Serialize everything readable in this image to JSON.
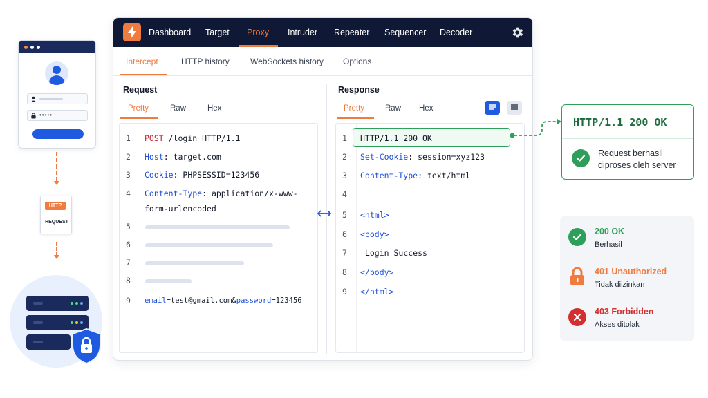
{
  "nav": {
    "items": [
      "Dashboard",
      "Target",
      "Proxy",
      "Intruder",
      "Repeater",
      "Sequencer",
      "Decoder"
    ],
    "active": "Proxy"
  },
  "subtabs": {
    "items": [
      "Intercept",
      "HTTP history",
      "WebSockets history",
      "Options"
    ],
    "active": "Intercept"
  },
  "request": {
    "title": "Request",
    "tabs": [
      "Pretty",
      "Raw",
      "Hex"
    ],
    "active_tab": "Pretty",
    "lines": [
      {
        "n": "1",
        "key": "POST",
        "rest": " /login HTTP/1.1"
      },
      {
        "n": "2",
        "key": "Host",
        "rest": ": target.com"
      },
      {
        "n": "3",
        "key": "Cookie",
        "rest": ": PHPSESSID=123456"
      },
      {
        "n": "4",
        "key": "Content-Type",
        "rest": ": application/x-www-",
        "cont": "form-urlencoded"
      },
      {
        "n": "5"
      },
      {
        "n": "6"
      },
      {
        "n": "7"
      },
      {
        "n": "8"
      },
      {
        "n": "9",
        "k1": "email",
        "v1": "=test@gmail.com&",
        "k2": "password",
        "v2": "=123456"
      }
    ]
  },
  "response": {
    "title": "Response",
    "tabs": [
      "Pretty",
      "Raw",
      "Hex"
    ],
    "active_tab": "Pretty",
    "lines": [
      {
        "n": "1",
        "text": "HTTP/1.1 200 OK"
      },
      {
        "n": "2",
        "key": "Set-Cookie",
        "rest": ": session=xyz123"
      },
      {
        "n": "3",
        "key": "Content-Type",
        "rest": ": text/html"
      },
      {
        "n": "4",
        "text": ""
      },
      {
        "n": "5",
        "tag": "<html>"
      },
      {
        "n": "6",
        "tag": "<body>"
      },
      {
        "n": "7",
        "text": " Login Success"
      },
      {
        "n": "8",
        "tag": "</body>"
      },
      {
        "n": "9",
        "tag": "</html>"
      }
    ]
  },
  "illustration": {
    "http_tag": "HTTP",
    "http_label": "REQUEST",
    "password_mask": "•••••"
  },
  "callout": {
    "status": "HTTP/1.1 200 OK",
    "message": "Request berhasil diproses oleh server"
  },
  "status_legend": [
    {
      "code": "200 OK",
      "desc": "Berhasil",
      "color": "#2e9e5b",
      "icon": "check-circle-icon"
    },
    {
      "code": "401 Unauthorized",
      "desc": "Tidak diizinkan",
      "color": "#f07b3f",
      "icon": "lock-icon"
    },
    {
      "code": "403 Forbidden",
      "desc": "Akses ditolak",
      "color": "#d32f2f",
      "icon": "x-circle-icon"
    }
  ],
  "colors": {
    "accent": "#f07b3f",
    "nav_bg": "#0f1834",
    "success": "#2e9e5b",
    "error": "#d32f2f",
    "link": "#1d4ed8"
  }
}
